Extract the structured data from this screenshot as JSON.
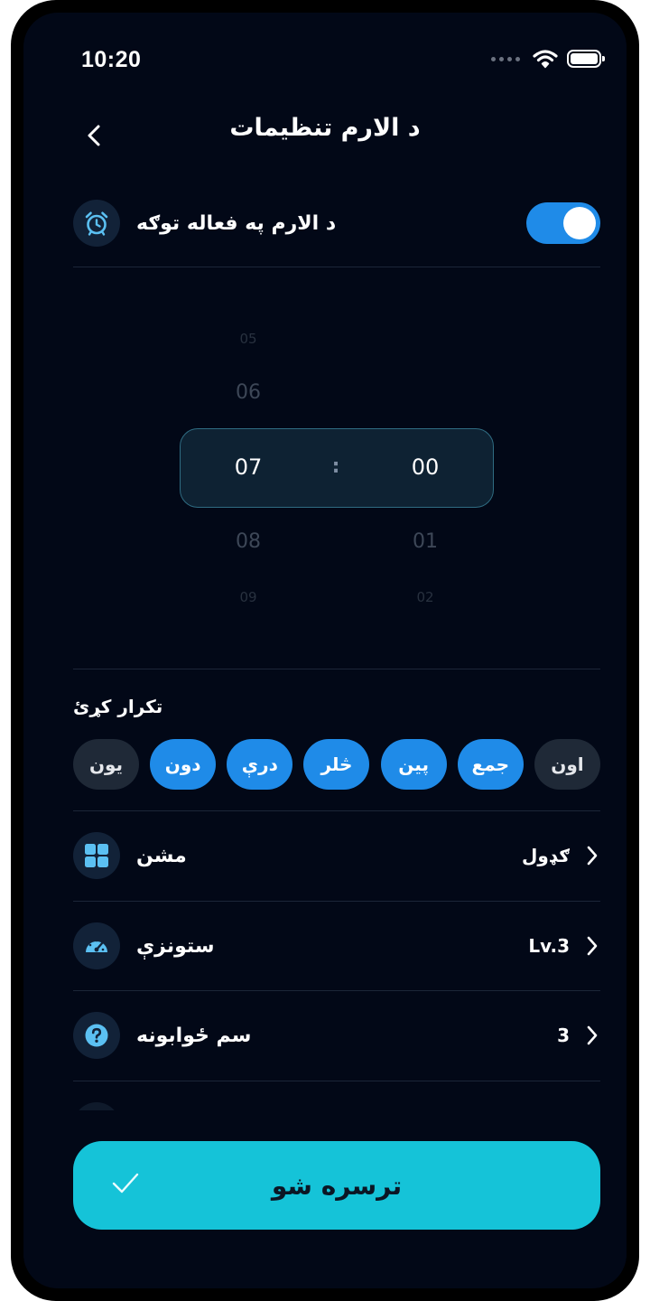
{
  "status_bar": {
    "time": "10:20"
  },
  "header": {
    "title": "د الارم تنظیمات"
  },
  "alarm_toggle": {
    "label": "د الارم په فعاله توګه",
    "enabled": true,
    "accent": "#1f8be8"
  },
  "time_picker": {
    "hours": {
      "far_above": "05",
      "above": "06",
      "selected": "07",
      "below": "08",
      "far_below": "09"
    },
    "minutes": {
      "selected": "00",
      "below": "01",
      "far_below": "02"
    },
    "separator": ":"
  },
  "repeat": {
    "title": "تکرار کړئ",
    "days": [
      {
        "label": "يون",
        "active": false
      },
      {
        "label": "دون",
        "active": true
      },
      {
        "label": "درې",
        "active": true
      },
      {
        "label": "څلر",
        "active": true
      },
      {
        "label": "پين",
        "active": true
      },
      {
        "label": "جمع",
        "active": true
      },
      {
        "label": "اون",
        "active": false
      }
    ]
  },
  "settings": [
    {
      "label": "مشن",
      "value": "ګډول",
      "icon": "grid-icon"
    },
    {
      "label": "ستونزې",
      "value": "Lv.3",
      "icon": "speedometer-icon"
    },
    {
      "label": "سم ځوابونه",
      "value": "3",
      "icon": "question-icon"
    }
  ],
  "submit": {
    "label": "ترسره شو",
    "color": "#15c3d8"
  }
}
